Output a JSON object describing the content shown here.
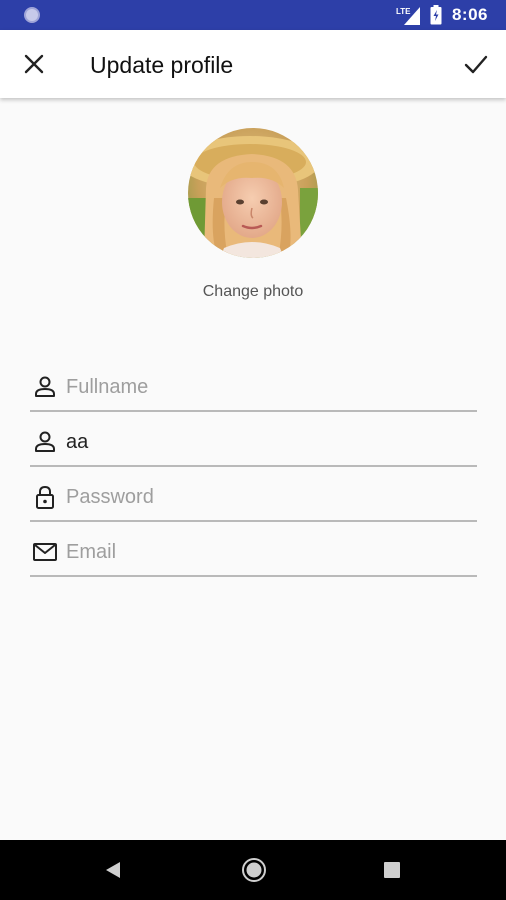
{
  "status_bar": {
    "time": "8:06",
    "network": "LTE",
    "color": "#2d3fa8"
  },
  "toolbar": {
    "title": "Update profile",
    "close_icon": "close-icon",
    "confirm_icon": "check-icon"
  },
  "profile": {
    "change_photo_label": "Change photo"
  },
  "fields": [
    {
      "icon": "person-icon",
      "placeholder": "Fullname",
      "value": ""
    },
    {
      "icon": "person-icon",
      "placeholder": "",
      "value": "aa"
    },
    {
      "icon": "lock-icon",
      "placeholder": "Password",
      "value": ""
    },
    {
      "icon": "mail-icon",
      "placeholder": "Email",
      "value": ""
    }
  ],
  "nav_bar": {
    "back_icon": "back-icon",
    "home_icon": "home-icon",
    "recent_icon": "recent-apps-icon"
  }
}
